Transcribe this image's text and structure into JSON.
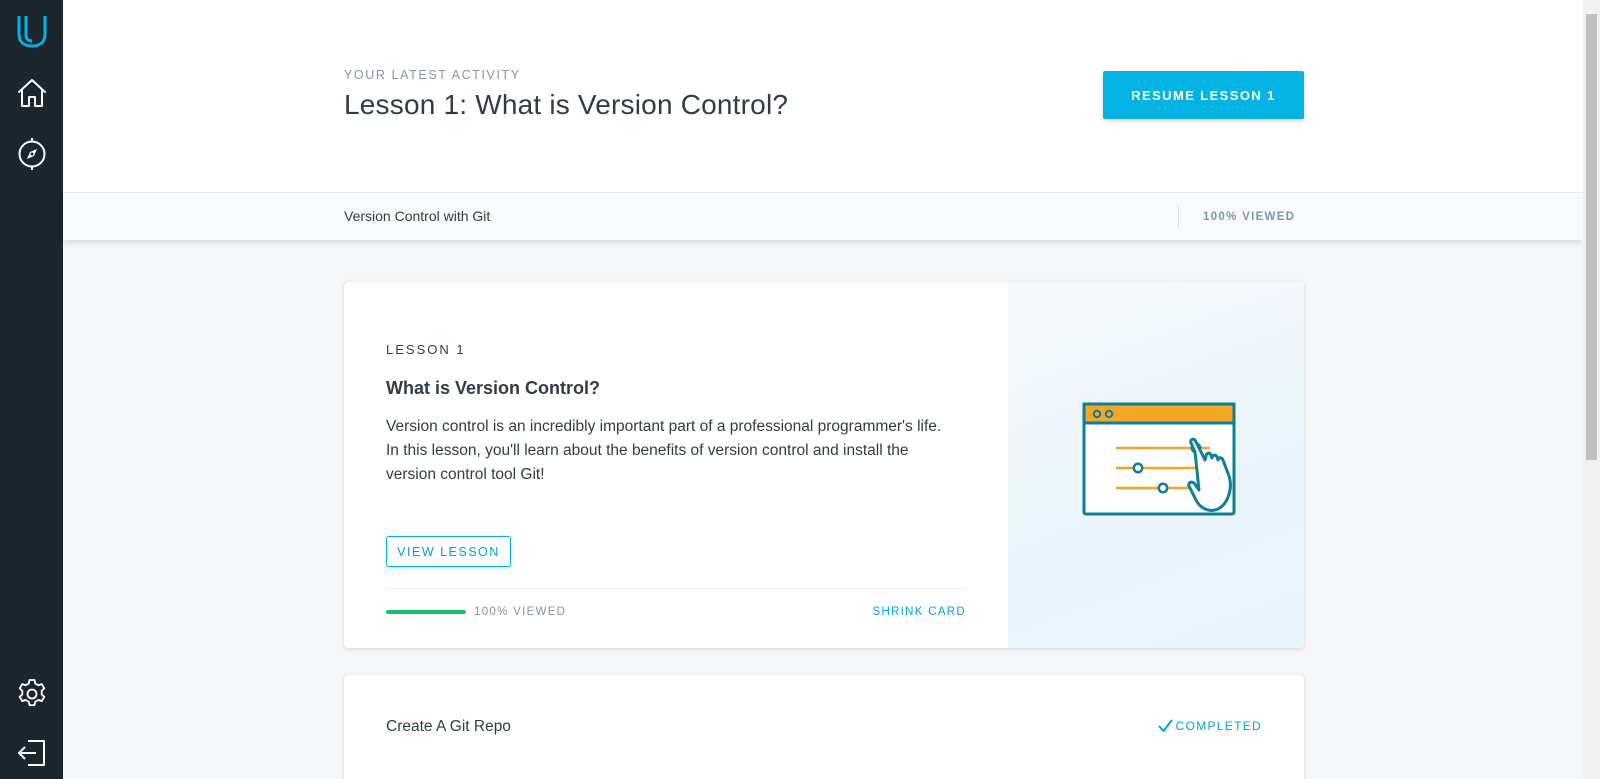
{
  "sidebar": {
    "items": [
      {
        "icon": "udacity-logo-icon"
      },
      {
        "icon": "home-icon"
      },
      {
        "icon": "compass-icon"
      },
      {
        "icon": "gear-icon"
      },
      {
        "icon": "logout-icon"
      }
    ]
  },
  "header": {
    "eyebrow": "YOUR LATEST ACTIVITY",
    "title": "Lesson 1: What is Version Control?",
    "resume_label": "RESUME LESSON 1"
  },
  "strip": {
    "course_title": "Version Control with Git",
    "viewed": "100% VIEWED"
  },
  "lesson_card": {
    "label": "LESSON 1",
    "title": "What is Version Control?",
    "description": "Version control is an incredibly important part of a professional programmer's life. In this lesson, you'll learn about the benefits of version control and install the version control tool Git!",
    "view_label": "VIEW LESSON",
    "progress_percent": 100,
    "viewed": "100% VIEWED",
    "shrink_label": "SHRINK CARD"
  },
  "next_card": {
    "title": "Create A Git Repo",
    "status": "COMPLETED"
  },
  "colors": {
    "sidebar": "#1c262f",
    "accent": "#02b3e4",
    "progress": "#15c26b",
    "illustration_orange": "#f5a623",
    "illustration_teal": "#0c7f9b"
  }
}
